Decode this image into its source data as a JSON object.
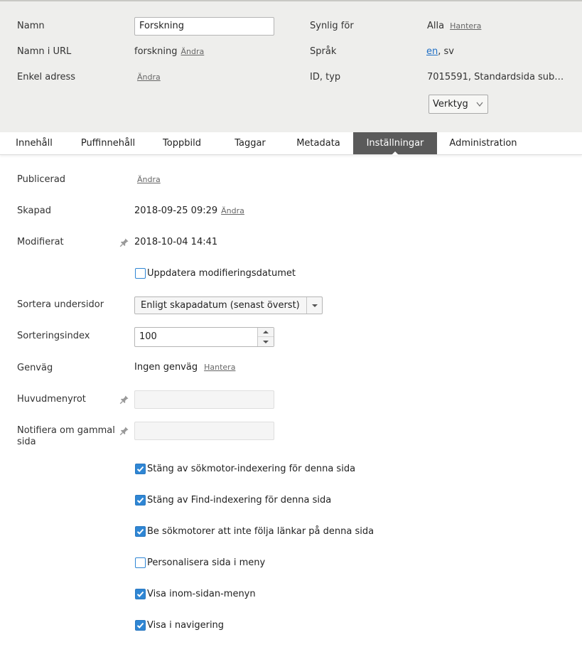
{
  "header": {
    "name_label": "Namn",
    "name_value": "Forskning",
    "url_label": "Namn i URL",
    "url_value": "forskning",
    "url_change": "Ändra",
    "simple_address_label": "Enkel adress",
    "simple_address_change": "Ändra",
    "visible_for_label": "Synlig för",
    "visible_for_value": "Alla",
    "visible_for_manage": "Hantera",
    "language_label": "Språk",
    "language_link": "en",
    "language_rest": ", sv",
    "id_label": "ID, typ",
    "id_value": "7015591, Standardsida sub…",
    "tools_button": "Verktyg"
  },
  "tabs": [
    {
      "label": "Innehåll",
      "active": false
    },
    {
      "label": "Puffinnehåll",
      "active": false
    },
    {
      "label": "Toppbild",
      "active": false
    },
    {
      "label": "Taggar",
      "active": false
    },
    {
      "label": "Metadata",
      "active": false
    },
    {
      "label": "Inställningar",
      "active": true
    },
    {
      "label": "Administration",
      "active": false
    }
  ],
  "settings": {
    "published_label": "Publicerad",
    "published_change": "Ändra",
    "created_label": "Skapad",
    "created_value": "2018-09-25 09:29",
    "created_change": "Ändra",
    "modified_label": "Modifierat",
    "modified_value": "2018-10-04 14:41",
    "update_modified_checkbox": "Uppdatera modifieringsdatumet",
    "sort_label": "Sortera undersidor",
    "sort_value": "Enligt skapadatum (senast överst)",
    "sortindex_label": "Sorteringsindex",
    "sortindex_value": "100",
    "shortcut_label": "Genväg",
    "shortcut_value": "Ingen genväg",
    "shortcut_manage": "Hantera",
    "main_menu_root_label": "Huvudmenyrot",
    "notify_old_label_1": "Notifiera om gammal",
    "notify_old_label_2": "sida"
  },
  "checkboxes": [
    {
      "label": "Stäng av sökmotor-indexering för denna sida",
      "checked": true
    },
    {
      "label": "Stäng av Find-indexering för denna sida",
      "checked": true
    },
    {
      "label": "Be sökmotorer att inte följa länkar på denna sida",
      "checked": true
    },
    {
      "label": "Personalisera sida i meny",
      "checked": false
    },
    {
      "label": "Visa inom-sidan-menyn",
      "checked": true
    },
    {
      "label": "Visa i navigering",
      "checked": true
    }
  ],
  "colors": {
    "header_bg": "#eeeeec",
    "active_tab_bg": "#5a5a5a",
    "checkbox_blue": "#2f86d4",
    "link_blue": "#1f6fc5"
  }
}
